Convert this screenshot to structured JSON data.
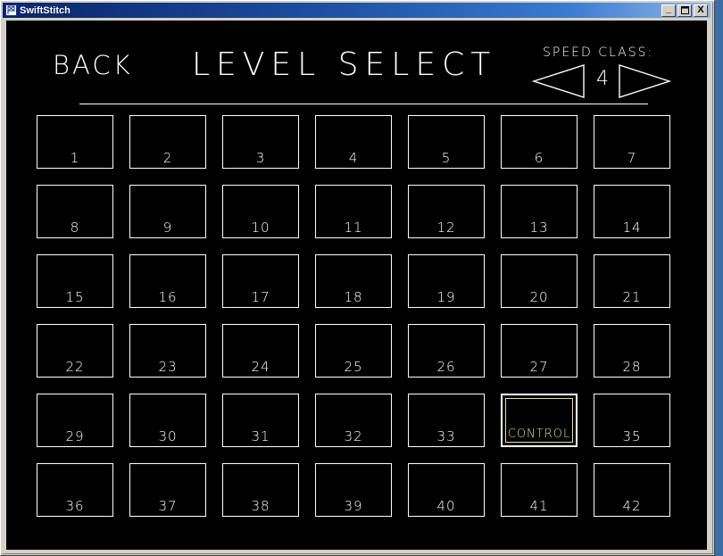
{
  "window": {
    "title": "SwiftStitch",
    "icon": "app-flag-icon",
    "buttons": {
      "minimize": "_",
      "maximize": "□",
      "close": "X"
    }
  },
  "screen": {
    "back_label": "BACK",
    "page_title": "LEVEL SELECT",
    "speed_class": {
      "label": "SPEED CLASS:",
      "value": "4",
      "prev_icon": "triangle-left-icon",
      "next_icon": "triangle-right-icon"
    },
    "colors": {
      "background": "#000000",
      "foreground": "#ffffff",
      "selected": "#e8e08a",
      "titlebar_start": "#0a246a",
      "titlebar_end": "#8fb8e8",
      "desktop": "#3a6ea5"
    },
    "grid": {
      "columns": 7,
      "rows": 6,
      "tiles": [
        {
          "label": "1",
          "selected": false
        },
        {
          "label": "2",
          "selected": false
        },
        {
          "label": "3",
          "selected": false
        },
        {
          "label": "4",
          "selected": false
        },
        {
          "label": "5",
          "selected": false
        },
        {
          "label": "6",
          "selected": false
        },
        {
          "label": "7",
          "selected": false
        },
        {
          "label": "8",
          "selected": false
        },
        {
          "label": "9",
          "selected": false
        },
        {
          "label": "10",
          "selected": false
        },
        {
          "label": "11",
          "selected": false
        },
        {
          "label": "12",
          "selected": false
        },
        {
          "label": "13",
          "selected": false
        },
        {
          "label": "14",
          "selected": false
        },
        {
          "label": "15",
          "selected": false
        },
        {
          "label": "16",
          "selected": false
        },
        {
          "label": "17",
          "selected": false
        },
        {
          "label": "18",
          "selected": false
        },
        {
          "label": "19",
          "selected": false
        },
        {
          "label": "20",
          "selected": false
        },
        {
          "label": "21",
          "selected": false
        },
        {
          "label": "22",
          "selected": false
        },
        {
          "label": "23",
          "selected": false
        },
        {
          "label": "24",
          "selected": false
        },
        {
          "label": "25",
          "selected": false
        },
        {
          "label": "26",
          "selected": false
        },
        {
          "label": "27",
          "selected": false
        },
        {
          "label": "28",
          "selected": false
        },
        {
          "label": "29",
          "selected": false
        },
        {
          "label": "30",
          "selected": false
        },
        {
          "label": "31",
          "selected": false
        },
        {
          "label": "32",
          "selected": false
        },
        {
          "label": "33",
          "selected": false
        },
        {
          "label": "CONTROL",
          "selected": true
        },
        {
          "label": "35",
          "selected": false
        },
        {
          "label": "36",
          "selected": false
        },
        {
          "label": "37",
          "selected": false
        },
        {
          "label": "38",
          "selected": false
        },
        {
          "label": "39",
          "selected": false
        },
        {
          "label": "40",
          "selected": false
        },
        {
          "label": "41",
          "selected": false
        },
        {
          "label": "42",
          "selected": false
        }
      ]
    }
  }
}
